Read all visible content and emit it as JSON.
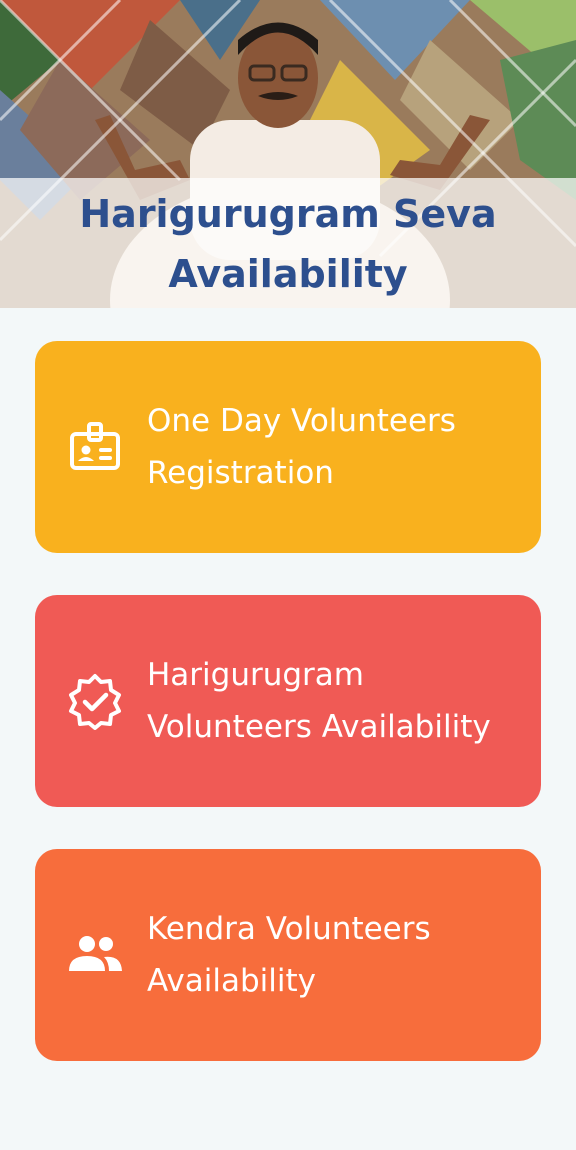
{
  "header": {
    "title_line1": "Harigurugram Seva",
    "title_line2": "Availability"
  },
  "menu": [
    {
      "line1": "One Day Volunteers",
      "line2": "Registration",
      "icon": "id-badge-icon",
      "color": "#f9b11e"
    },
    {
      "line1": "Harigurugram",
      "line2": "Volunteers Availability",
      "icon": "verified-badge-icon",
      "color": "#f05a55"
    },
    {
      "line1": "Kendra Volunteers",
      "line2": "Availability",
      "icon": "group-icon",
      "color": "#f76d3c"
    }
  ]
}
